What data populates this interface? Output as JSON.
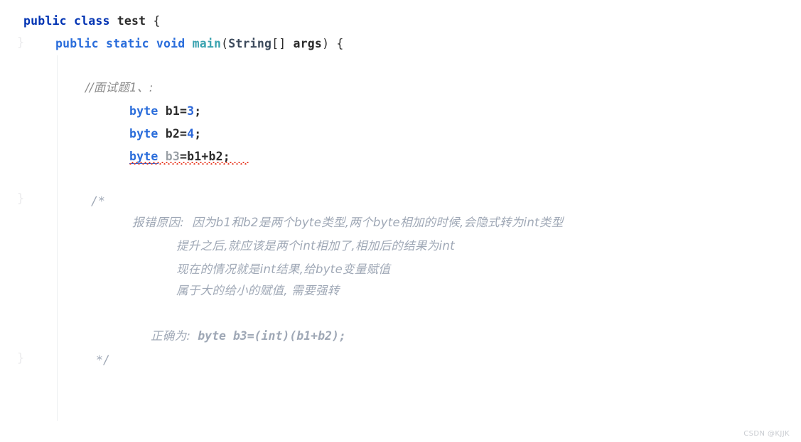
{
  "editor": {
    "language": "Java",
    "background_color": "#ffffff",
    "theme": "light",
    "colors": {
      "keyword": "#0033b3",
      "keyword_alt": "#2a6ddb",
      "identifier": "#2b2b2b",
      "class_name": "#3c4a5c",
      "method_name": "#3aa3b0",
      "number": "#2a66d8",
      "line_comment": "#8c8c8c",
      "block_comment": "#9fa8b6",
      "unused_variable": "#9aa0a6",
      "error_underline": "#e8402a",
      "indent_guide": "#eceff1",
      "fold_marker": "#ebebed",
      "watermark": "#c9ccd1"
    }
  },
  "gutter": {
    "fold_markers": [
      "}",
      "}",
      "}"
    ]
  },
  "code": {
    "line1": {
      "kw_public": "public",
      "kw_class": "class",
      "name": "test",
      "brace": "{"
    },
    "line2": {
      "kw_public": "public",
      "kw_static": "static",
      "kw_void": "void",
      "method": "main",
      "paren_open": "(",
      "type_string": "String",
      "brackets": "[]",
      "arg": "args",
      "paren_close": ")",
      "brace": "{"
    },
    "line_comment_1": "//面试题1、:",
    "decl_b1": {
      "type": "byte",
      "name": "b1",
      "assign": "=",
      "value": "3",
      "semi": ";"
    },
    "decl_b2": {
      "type": "byte",
      "name": "b2",
      "assign": "=",
      "value": "4",
      "semi": ";"
    },
    "decl_b3": {
      "type": "byte",
      "name": "b3",
      "rest": "=b1+b2;",
      "has_error": true
    },
    "block_comment_open": "/*",
    "block_comment_close": "*/",
    "block_comment_lines": [
      {
        "label": "报错原因:",
        "text": "因为b1和b2是两个byte类型,两个byte相加的时候,会隐式转为int类型"
      },
      {
        "label": "",
        "text": "提升之后,就应该是两个int相加了,相加后的结果为int"
      },
      {
        "label": "",
        "text": "现在的情况就是int结果,给byte变量赋值"
      },
      {
        "label": "",
        "text": "属于大的给小的赋值, 需要强转"
      }
    ],
    "block_comment_solution": {
      "label": "正确为:",
      "code": "byte b3=(int)(b1+b2);"
    }
  },
  "watermark": {
    "text": "CSDN @KJJK"
  }
}
